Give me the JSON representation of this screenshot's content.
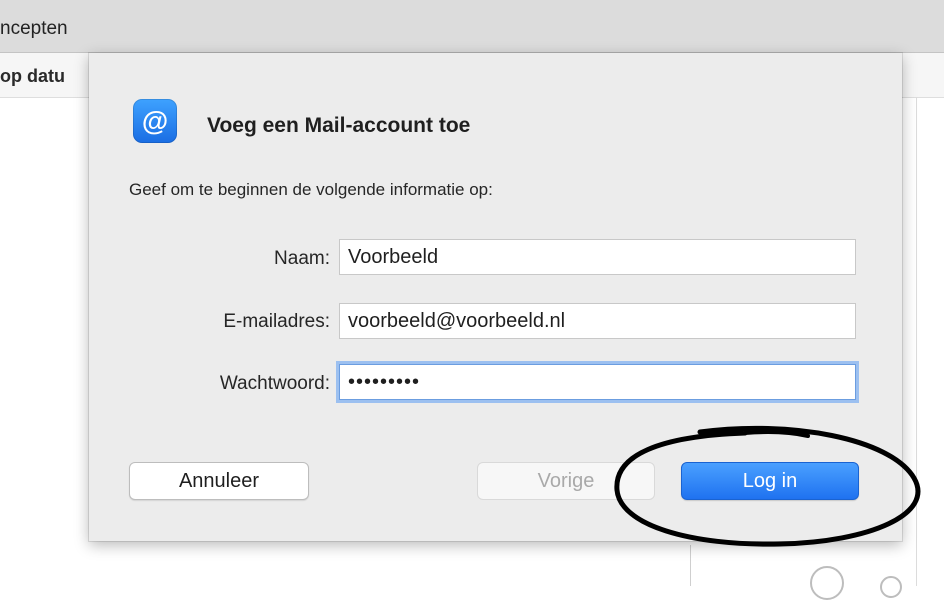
{
  "background": {
    "toolbar_label": "ncepten",
    "column_label": "op datu"
  },
  "dialog": {
    "icon": "at-sign-icon",
    "icon_glyph": "@",
    "title": "Voeg een Mail-account toe",
    "subtitle": "Geef om te beginnen de volgende informatie op:",
    "fields": {
      "name": {
        "label": "Naam:",
        "value": "Voorbeeld"
      },
      "email": {
        "label": "E-mailadres:",
        "value": "voorbeeld@voorbeeld.nl"
      },
      "password": {
        "label": "Wachtwoord:",
        "value": "•••••••••"
      }
    },
    "buttons": {
      "cancel": "Annuleer",
      "previous": "Vorige",
      "login": "Log in"
    }
  },
  "colors": {
    "accent": "#1f72f0",
    "focus_ring": "#9cc0f0",
    "annotation": "#000000"
  }
}
